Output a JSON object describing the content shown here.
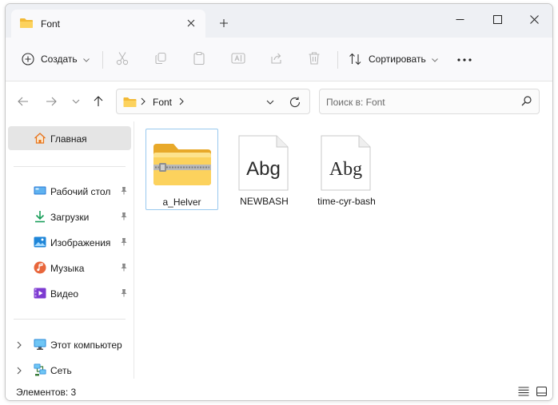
{
  "tab": {
    "title": "Font"
  },
  "toolbar": {
    "create_label": "Создать",
    "sort_label": "Сортировать"
  },
  "address": {
    "segments": [
      "Font"
    ]
  },
  "search": {
    "placeholder": "Поиск в: Font"
  },
  "sidebar": {
    "home_label": "Главная",
    "quick_access": [
      {
        "label": "Рабочий стол",
        "icon": "desktop-icon",
        "pinned": true
      },
      {
        "label": "Загрузки",
        "icon": "downloads-icon",
        "pinned": true
      },
      {
        "label": "Изображения",
        "icon": "pictures-icon",
        "pinned": true
      },
      {
        "label": "Музыка",
        "icon": "music-icon",
        "pinned": true
      },
      {
        "label": "Видео",
        "icon": "video-icon",
        "pinned": true
      }
    ],
    "this_pc_label": "Этот компьютер",
    "network_label": "Сеть"
  },
  "files": [
    {
      "name": "a_Helver",
      "type": "zip-folder",
      "selected": true
    },
    {
      "name": "NEWBASH",
      "type": "font",
      "preview": "Abg"
    },
    {
      "name": "time-cyr-bash",
      "type": "font",
      "preview": "Abg"
    }
  ],
  "status": {
    "items_text": "Элементов: 3"
  },
  "colors": {
    "accent": "#0067c0",
    "folder_yellow": "#f6c343",
    "selection_border": "#99c9ef",
    "titlebar_bg": "#eef0f4"
  }
}
